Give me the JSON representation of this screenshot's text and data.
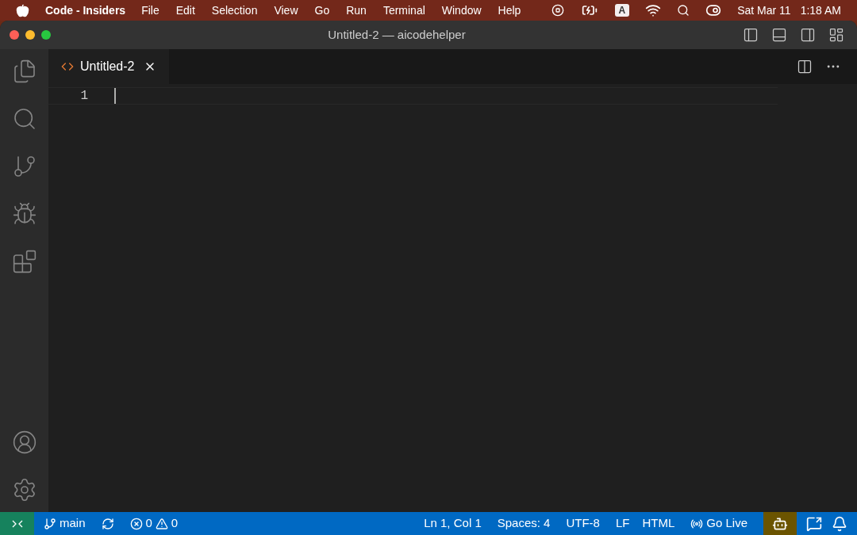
{
  "menu_bar": {
    "app": "Code - Insiders",
    "items": [
      "File",
      "Edit",
      "Selection",
      "View",
      "Go",
      "Run",
      "Terminal",
      "Window",
      "Help"
    ],
    "input_source": "A",
    "date": "Sat Mar 11",
    "time": "1:18 AM"
  },
  "window": {
    "title": "Untitled-2 — aicodehelper"
  },
  "tabs": [
    {
      "label": "Untitled-2",
      "selected": true
    }
  ],
  "editor": {
    "line_numbers": [
      "1"
    ]
  },
  "status_bar": {
    "branch": "main",
    "errors": "0",
    "warnings": "0",
    "position": "Ln 1, Col 1",
    "indentation": "Spaces: 4",
    "encoding": "UTF-8",
    "eol": "LF",
    "language": "HTML",
    "go_live": "Go Live"
  }
}
